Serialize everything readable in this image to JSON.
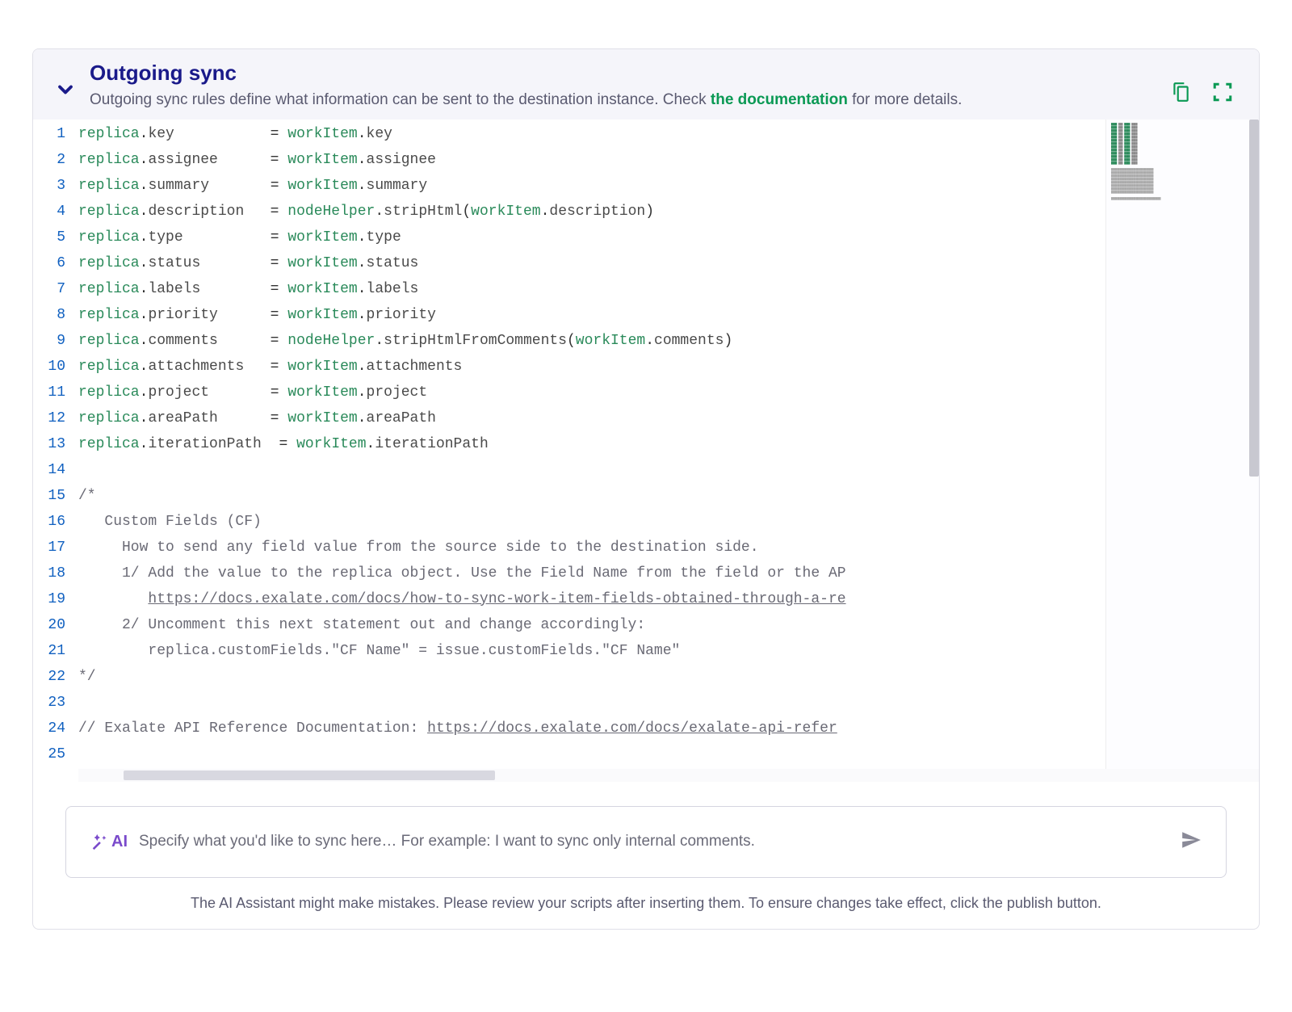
{
  "header": {
    "title": "Outgoing sync",
    "subtitle_pre": "Outgoing sync rules define what information can be sent to the destination instance. Check ",
    "doc_link_text": "the documentation",
    "subtitle_post": " for more details."
  },
  "editor": {
    "line_count": 25,
    "assignments": [
      {
        "lhs": "key",
        "rhs_obj": "workItem",
        "rhs_prop": "key",
        "pad": 9
      },
      {
        "lhs": "assignee",
        "rhs_obj": "workItem",
        "rhs_prop": "assignee",
        "pad": 4
      },
      {
        "lhs": "summary",
        "rhs_obj": "workItem",
        "rhs_prop": "summary",
        "pad": 5
      },
      {
        "lhs": "description",
        "rhs_obj": "nodeHelper",
        "rhs_prop": "stripHtml",
        "pad": 1,
        "call_arg_obj": "workItem",
        "call_arg_prop": "description"
      },
      {
        "lhs": "type",
        "rhs_obj": "workItem",
        "rhs_prop": "type",
        "pad": 8
      },
      {
        "lhs": "status",
        "rhs_obj": "workItem",
        "rhs_prop": "status",
        "pad": 6
      },
      {
        "lhs": "labels",
        "rhs_obj": "workItem",
        "rhs_prop": "labels",
        "pad": 6
      },
      {
        "lhs": "priority",
        "rhs_obj": "workItem",
        "rhs_prop": "priority",
        "pad": 4
      },
      {
        "lhs": "comments",
        "rhs_obj": "nodeHelper",
        "rhs_prop": "stripHtmlFromComments",
        "pad": 4,
        "call_arg_obj": "workItem",
        "call_arg_prop": "comments"
      },
      {
        "lhs": "attachments",
        "rhs_obj": "workItem",
        "rhs_prop": "attachments",
        "pad": 1
      },
      {
        "lhs": "project",
        "rhs_obj": "workItem",
        "rhs_prop": "project",
        "pad": 5
      },
      {
        "lhs": "areaPath",
        "rhs_obj": "workItem",
        "rhs_prop": "areaPath",
        "pad": 4
      },
      {
        "lhs": "iterationPath",
        "rhs_obj": "workItem",
        "rhs_prop": "iterationPath",
        "pad": 0
      }
    ],
    "comment_block": [
      "/*",
      "   Custom Fields (CF)",
      "     How to send any field value from the source side to the destination side.",
      "     1/ Add the value to the replica object. Use the Field Name from the field or the AP",
      "        https://docs.exalate.com/docs/how-to-sync-work-item-fields-obtained-through-a-re",
      "     2/ Uncomment this next statement out and change accordingly:",
      "        replica.customFields.\"CF Name\" = issue.customFields.\"CF Name\"",
      "*/"
    ],
    "api_ref_line_prefix": "// Exalate API Reference Documentation: ",
    "api_ref_url": "https://docs.exalate.com/docs/exalate-api-refer"
  },
  "ai": {
    "badge_text": "AI",
    "placeholder": "Specify what you'd like to sync here…  For example: I want to sync only internal comments.",
    "warning": "The AI Assistant might make mistakes. Please review your scripts after inserting them. To ensure changes take effect, click the publish button."
  }
}
